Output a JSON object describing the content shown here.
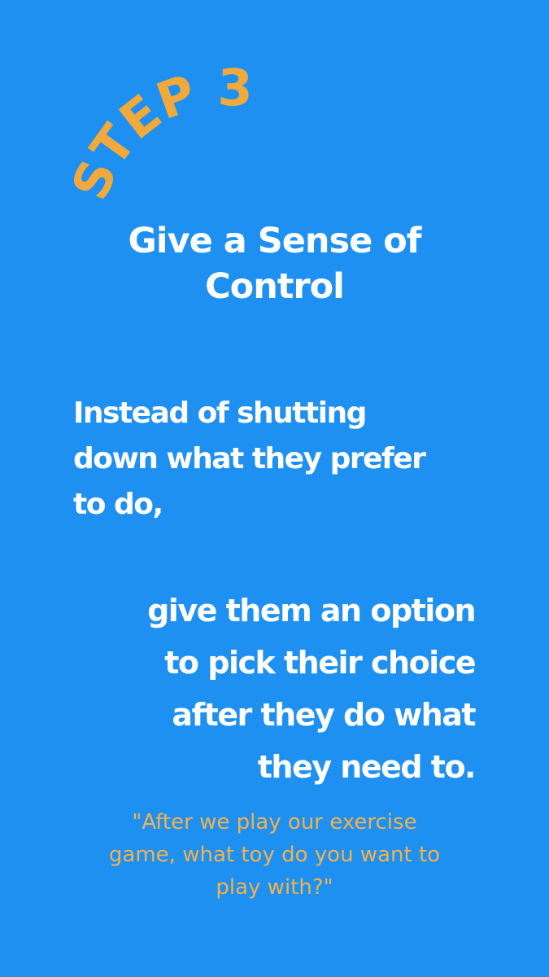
{
  "step_label": "STEP 3",
  "title_line1": "Give a Sense of",
  "title_line2": "Control",
  "intro": {
    "line1": "Instead of shutting",
    "line2": "down what they prefer",
    "line3": "to do,"
  },
  "advice": {
    "line1": "give them an option",
    "line2": "to pick their choice",
    "line3": "after they do what",
    "line4": "they need to."
  },
  "quote": {
    "line1": "\"After we play our exercise",
    "line2": "game, what toy do you want to",
    "line3": "play with?\""
  },
  "colors": {
    "background": "#1e90f2",
    "accent": "#f2a93b",
    "text": "#ffffff"
  }
}
